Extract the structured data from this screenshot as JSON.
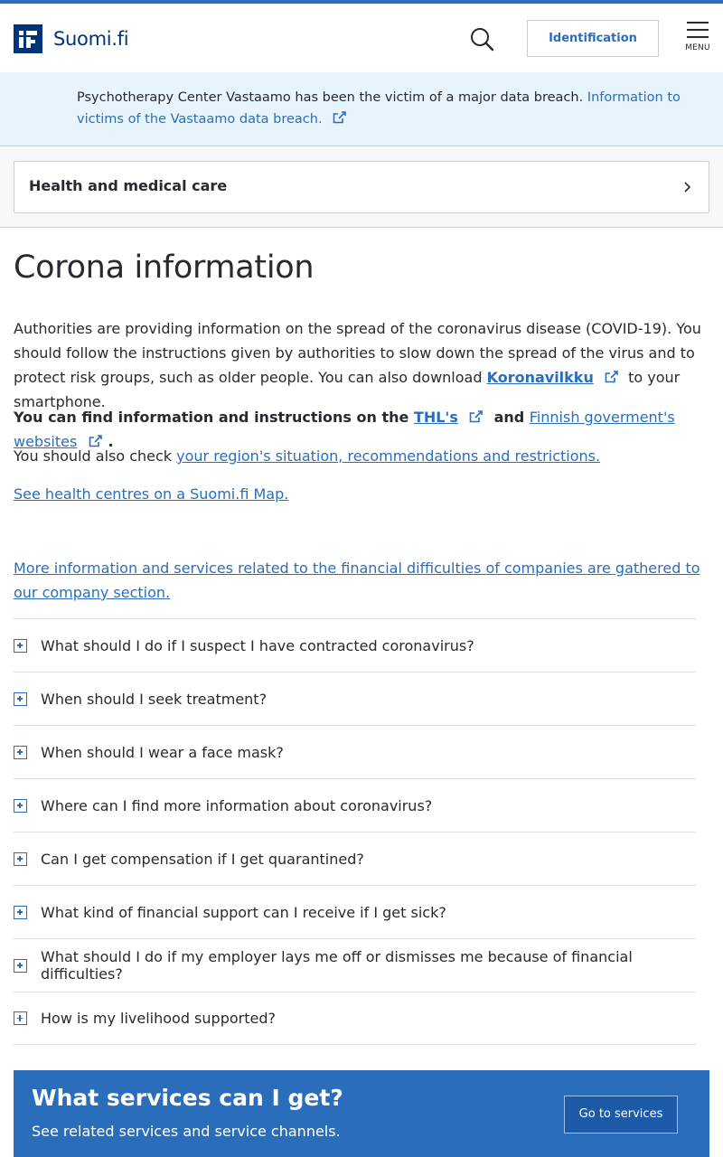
{
  "header": {
    "logo_text": "Suomi.fi",
    "identification_label": "Identification",
    "menu_label": "MENU"
  },
  "notice": {
    "text": "Psychotherapy Center Vastaamo has been the victim of a major data breach.",
    "link": "Information to victims of the Vastaamo data breach."
  },
  "breadcrumb": {
    "label": "Health and medical care"
  },
  "main": {
    "title": "Corona information",
    "p1_text": "Authorities are providing information on the spread of the coronavirus disease (COVID-19). You should follow the instructions given by authorities to slow down the spread of the virus and to protect risk groups, such as older people. You can also download",
    "p1_link": "Koronavilkku",
    "p1_after": "to your smartphone.",
    "p2_text": "You can find information and instructions on the",
    "p2_link1": "THL's",
    "p2_and": "and",
    "p2_link2": "Finnish goverment's websites",
    "p2_end": ".",
    "p3_text": "You should also check",
    "p3_link": "your region's situation, recommendations and restrictions.",
    "p4_link": "See health centres on a Suomi.fi Map.",
    "p5_link": "More information and services related to the financial difficulties of companies are gathered to our company section."
  },
  "faq": [
    "What should I do if I suspect I have contracted coronavirus?",
    "When should I seek treatment?",
    "When should I wear a face mask?",
    "Where can I find more information about coronavirus?",
    "Can I get compensation if I get quarantined?",
    "What kind of financial support can I receive if I get sick?",
    "What should I do if my employer lays me off or dismisses me because of financial difficulties?",
    "How is my livelihood supported?"
  ],
  "services": {
    "title": "What services can I get?",
    "subtitle": "See related services and service channels.",
    "button": "Go to services"
  },
  "colors": {
    "brand": "#003479",
    "link": "#2a6ebb",
    "notice_bg": "#e7f4fc"
  }
}
